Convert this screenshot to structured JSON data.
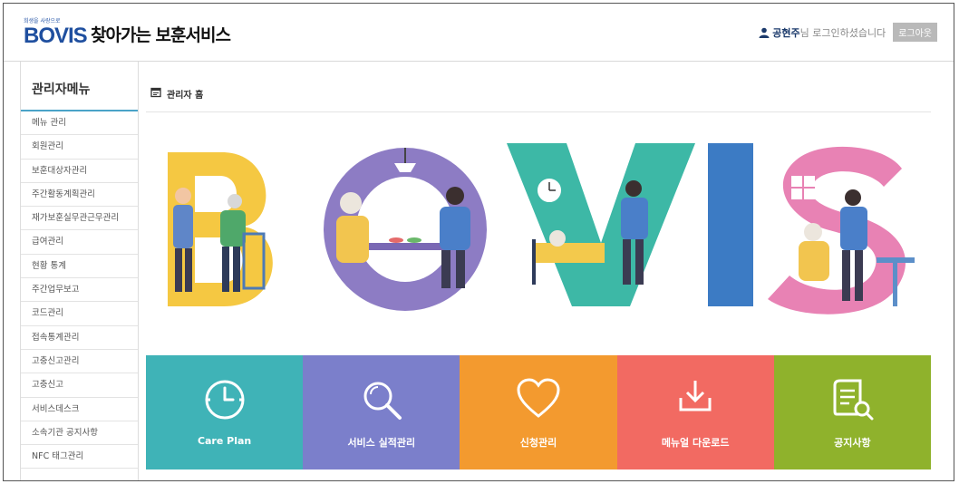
{
  "header": {
    "logo_small": "희생을 사랑으로",
    "logo_text": "BOVIS",
    "title": "찾아가는 보훈서비스",
    "user_icon": "user-icon",
    "user_name": "공현주",
    "greeting": "님 로그인하셨습니다",
    "logout_label": "로그아웃"
  },
  "sidebar": {
    "title": "관리자메뉴",
    "items": [
      {
        "label": "메뉴 관리"
      },
      {
        "label": "회원관리"
      },
      {
        "label": "보훈대상자관리"
      },
      {
        "label": "주간활동계획관리"
      },
      {
        "label": "재가보훈실무관근무관리"
      },
      {
        "label": "급여관리"
      },
      {
        "label": "현황 통계"
      },
      {
        "label": "주간업무보고"
      },
      {
        "label": "코드관리"
      },
      {
        "label": "접속통계관리"
      },
      {
        "label": "고충신고관리"
      },
      {
        "label": "고충신고"
      },
      {
        "label": "서비스데스크"
      },
      {
        "label": "소속기관 공지사항"
      },
      {
        "label": "NFC 태그관리"
      }
    ]
  },
  "breadcrumb": {
    "icon": "home-icon",
    "label": "관리자 홈"
  },
  "banner": {
    "text": "BOVIS",
    "colors": {
      "b": "#f5c842",
      "o": "#8d7cc4",
      "v": "#3db8a6",
      "i": "#3c7bc4",
      "s": "#e882b4"
    }
  },
  "tiles": [
    {
      "label": "Care Plan",
      "icon": "clock-icon",
      "color": "#3fb3b7"
    },
    {
      "label": "서비스 실적관리",
      "icon": "search-icon",
      "color": "#7b7fcb"
    },
    {
      "label": "신청관리",
      "icon": "heart-icon",
      "color": "#f39a2f"
    },
    {
      "label": "메뉴얼 다운로드",
      "icon": "download-icon",
      "color": "#f26a62"
    },
    {
      "label": "공지사항",
      "icon": "notice-icon",
      "color": "#8fb22c"
    }
  ]
}
